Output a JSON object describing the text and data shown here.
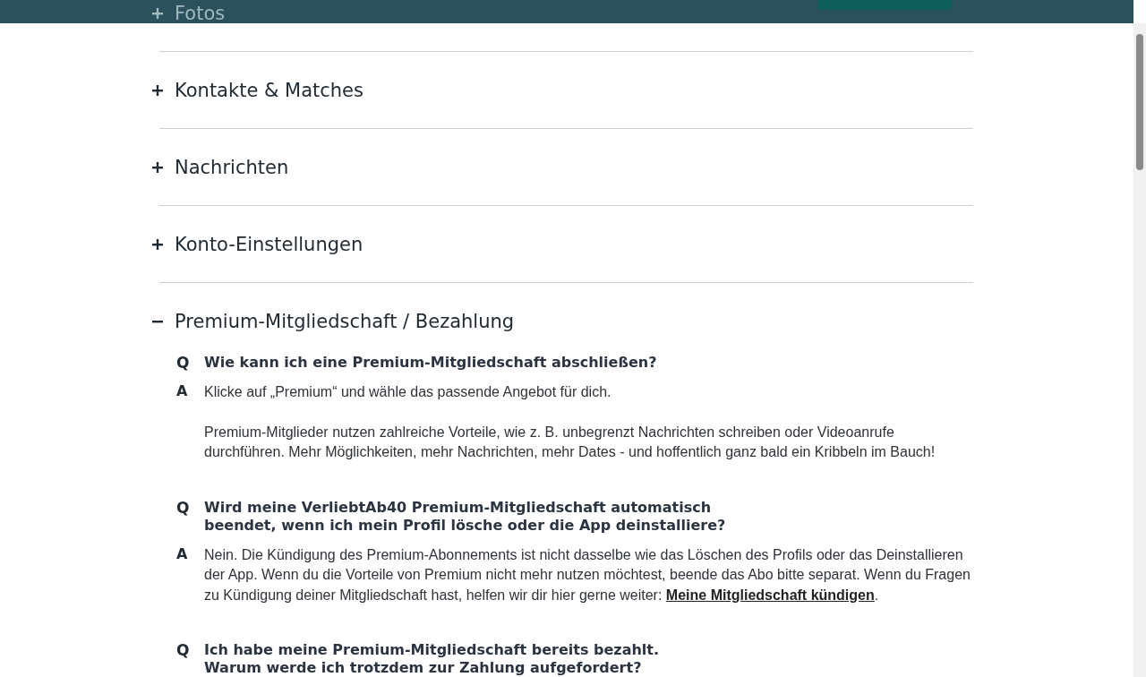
{
  "sections": [
    {
      "title": "Fotos",
      "expanded": false
    },
    {
      "title": "Kontakte & Matches",
      "expanded": false
    },
    {
      "title": "Nachrichten",
      "expanded": false
    },
    {
      "title": "Konto-Einstellungen",
      "expanded": false
    },
    {
      "title": "Premium-Mitgliedschaft / Bezahlung",
      "expanded": true,
      "items": [
        {
          "q_mark": "Q",
          "question": [
            "Wie kann ich eine Premium-Mitgliedschaft abschließen?"
          ],
          "a_mark": "A",
          "answer": [
            {
              "text": "Klicke auf „Premium“ und wähle das passende Angebot für dich."
            },
            {
              "text": "Premium-Mitglieder nutzen zahlreiche Vorteile, wie z. B. unbegrenzt Nachrichten schreiben oder Videoanrufe durchführen. Mehr Möglichkeiten, mehr Nachrichten, mehr Dates - und hoffentlich ganz bald ein Kribbeln im Bauch!"
            }
          ]
        },
        {
          "q_mark": "Q",
          "question": [
            "Wird meine VerliebtAb40 Premium-Mitgliedschaft automatisch",
            "beendet, wenn ich mein Profil lösche oder die App deinstalliere?"
          ],
          "a_mark": "A",
          "answer": [
            {
              "text": "Nein. Die Kündigung des Premium-Abonnements ist nicht dasselbe wie das Löschen des Profils oder das Deinstallieren der App. Wenn du die Vorteile von Premium nicht mehr nutzen möchtest, beende das Abo bitte separat. Wenn du Fragen zu Kündigung deiner Mitgliedschaft hast, helfen wir dir hier gerne weiter: ",
              "link": "Meine Mitgliedschaft kündigen",
              "tail": "."
            }
          ]
        },
        {
          "q_mark": "Q",
          "question": [
            "Ich habe meine Premium-Mitgliedschaft bereits bezahlt.",
            "Warum werde ich trotzdem zur Zahlung aufgefordert?"
          ]
        }
      ]
    }
  ]
}
